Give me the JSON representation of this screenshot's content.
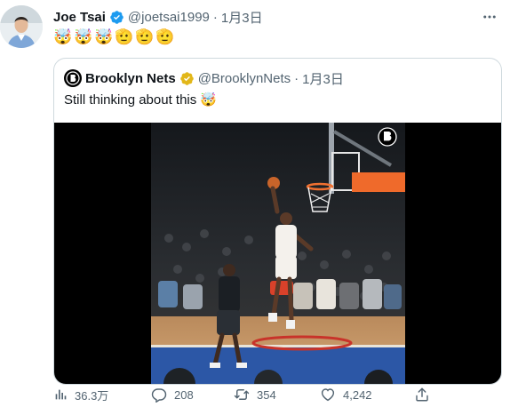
{
  "tweet": {
    "author_name": "Joe Tsai",
    "handle": "@joetsai1999",
    "separator": "·",
    "date": "1月3日",
    "emojis": [
      "🤯",
      "🤯",
      "🤯",
      "🫡",
      "🫡",
      "🫡"
    ]
  },
  "quoted": {
    "author_name": "Brooklyn Nets",
    "handle": "@BrooklynNets",
    "separator": "·",
    "date": "1月3日",
    "text": "Still thinking about this",
    "text_emoji": "🤯"
  },
  "metrics": {
    "views": "36.3万",
    "replies": "208",
    "retweets": "354",
    "likes": "4,242"
  },
  "icons": [
    "verified-badge-icon",
    "gold-verified-badge-icon",
    "more-icon",
    "views-icon",
    "reply-icon",
    "retweet-icon",
    "like-icon",
    "share-icon",
    "nets-logo-icon"
  ],
  "colors": {
    "verified_blue": "#1d9bf0",
    "verified_gold": "#e2b719",
    "muted_text": "#536471",
    "border": "#cfd9de"
  }
}
